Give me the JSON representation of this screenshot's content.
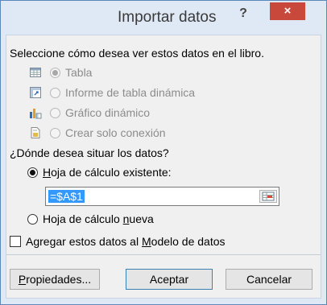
{
  "window": {
    "title": "Importar datos",
    "help_glyph": "?",
    "close_glyph": "×",
    "colors": {
      "accent": "#5a88b8",
      "close": "#c9483c",
      "selection": "#3399ff"
    }
  },
  "view_prompt": "Seleccione cómo desea ver estos datos en el libro.",
  "view_options": [
    {
      "label": "Tabla",
      "icon": "table-icon",
      "checked": true,
      "enabled": false
    },
    {
      "label": "Informe de tabla dinámica",
      "icon": "pivot-table-icon",
      "checked": false,
      "enabled": false
    },
    {
      "label": "Gráfico dinámico",
      "icon": "pivot-chart-icon",
      "checked": false,
      "enabled": false
    },
    {
      "label": "Crear solo conexión",
      "icon": "connection-icon",
      "checked": false,
      "enabled": false
    }
  ],
  "location_prompt": "¿Dónde desea situar los datos?",
  "existing_sheet": {
    "prefix": "",
    "mnemonic": "H",
    "rest": "oja de cálculo existente:",
    "checked": true
  },
  "range_input": {
    "value": "=$A$1",
    "button_icon": "range-select-icon"
  },
  "new_sheet": {
    "before": "Hoja de cálculo ",
    "mnemonic": "n",
    "after": "ueva",
    "checked": false
  },
  "data_model_checkbox": {
    "before": "Agregar estos datos al ",
    "mnemonic": "M",
    "after": "odelo de datos",
    "checked": false
  },
  "buttons": {
    "properties": {
      "mnemonic": "P",
      "rest": "ropiedades..."
    },
    "accept": "Aceptar",
    "cancel": "Cancelar"
  }
}
